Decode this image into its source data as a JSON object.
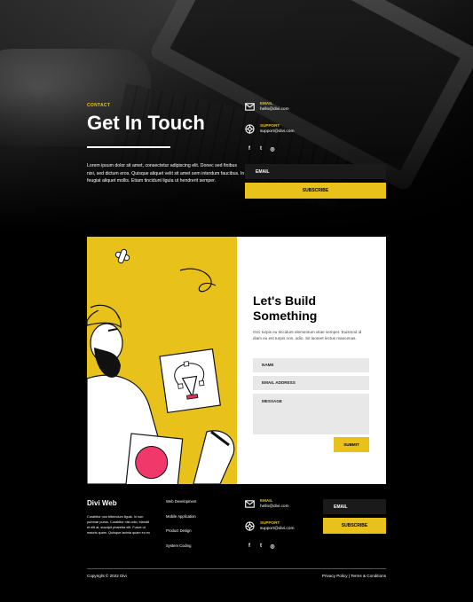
{
  "hero": {
    "eyebrow": "CONTACT",
    "title": "Get In Touch",
    "body": "Lorem ipsum dolor sit amet, consectetur adipiscing elit. Donec sed finibus nisi, sed dictum eros. Quisque aliquet velit sit amet sem interdum faucibus. In feugiat aliquet mollis. Etiam tincidunt ligula ut hendrerit semper."
  },
  "contact": {
    "email_label": "EMAIL",
    "email_value": "hello@divi.com",
    "support_label": "SUPPORT",
    "support_value": "support@divi.com"
  },
  "social_icons": [
    "facebook-icon",
    "twitter-icon",
    "instagram-icon"
  ],
  "social_glyphs": [
    "f",
    "t",
    "◎"
  ],
  "newsletter": {
    "email_placeholder": "EMAIL",
    "subscribe_label": "SUBSCRIBE"
  },
  "form": {
    "title": "Let's Build Something",
    "body": "Orci turpis eu tincidunt elementum vitae semper. Euismod id diam eu est turpis non, odio. Sit laoreet lectus maecenas.",
    "name_placeholder": "NAME",
    "email_placeholder": "EMAIL ADDRESS",
    "message_placeholder": "MESSAGE",
    "submit_label": "SUBMIT"
  },
  "footer": {
    "brand": "Divi Web",
    "text": "Curabitur non bibendum ligula. In non pulvinar purus. Curabitur nisi odio, blandit et elit at, suscipit pharetra elit. Fusce ut mauris quam. Quisque lacinia quam eu ex",
    "links": [
      "Web Development",
      "Mobile Application",
      "Product Design",
      "System Coding"
    ],
    "email_label": "EMAIL",
    "email_value": "hello@divi.com",
    "support_label": "SUPPORT",
    "support_value": "support@divi.com",
    "newsletter_placeholder": "EMAIL",
    "subscribe_label": "SUBSCRIBE",
    "copyright": "Copyright © 2022 Divi",
    "legal": "Privacy Policy | Terms & Conditions"
  },
  "colors": {
    "accent": "#e8c21a",
    "background": "#000000",
    "field": "#e8e8e8"
  }
}
